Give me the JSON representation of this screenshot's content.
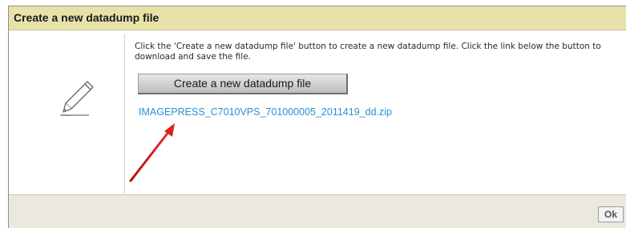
{
  "dialog": {
    "title": "Create a new datadump file",
    "description": "Click the 'Create a new datadump file' button to create a new datadump file. Click the link below the button to download and save the file.",
    "create_button_label": "Create a new datadump file",
    "download_link_text": "IMAGEPRESS_C7010VPS_701000005_2011419_dd.zip",
    "ok_button_label": "Ok",
    "icon": "pencil-icon",
    "annotation": "red-arrow"
  },
  "colors": {
    "titlebar_bg": "#e8e2aa",
    "footer_bg": "#ebe9dd",
    "link_color": "#2a8fd6",
    "arrow_color": "#e02020"
  }
}
